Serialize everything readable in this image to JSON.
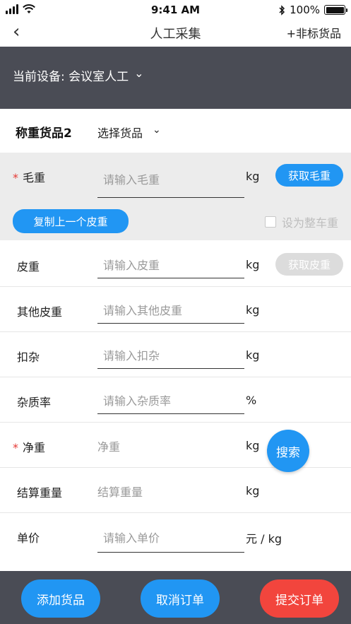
{
  "status_bar": {
    "time": "9:41 AM",
    "battery": "100%",
    "battery_level": 1.0
  },
  "nav": {
    "back_glyph": "‹",
    "title": "人工采集",
    "right_action": "+非标货品"
  },
  "device": {
    "label": "当前设备: 会议室人工",
    "chevron": "⌄"
  },
  "goods": {
    "label": "称重货品2",
    "select_label": "选择货品",
    "chevron": "⌄"
  },
  "gross": {
    "label": "毛重",
    "required_mark": "*",
    "placeholder": "请输入毛重",
    "unit": "kg",
    "fetch_button": "获取毛重",
    "copy_button": "复制上一个皮重",
    "whole_truck_checkbox": "设为整车重"
  },
  "fields": {
    "tare": {
      "label": "皮重",
      "placeholder": "请输入皮重",
      "unit": "kg",
      "fetch_button": "获取皮重"
    },
    "other_tare": {
      "label": "其他皮重",
      "placeholder": "请输入其他皮重",
      "unit": "kg"
    },
    "deduction": {
      "label": "扣杂",
      "placeholder": "请输入扣杂",
      "unit": "kg"
    },
    "impurity_rate": {
      "label": "杂质率",
      "placeholder": "请输入杂质率",
      "unit": "%"
    },
    "net": {
      "label": "净重",
      "required_mark": "*",
      "value": "净重",
      "unit": "kg"
    },
    "settle": {
      "label": "结算重量",
      "value": "结算重量",
      "unit": "kg"
    },
    "price": {
      "label": "单价",
      "placeholder": "请输入单价",
      "unit": "元 / kg"
    }
  },
  "search_button": "搜索",
  "bottom": {
    "add": "添加货品",
    "cancel": "取消订单",
    "submit": "提交订单"
  },
  "colors": {
    "accent": "#2196f3",
    "danger": "#f2453d",
    "dark_bar": "#4a4c55",
    "gray_section": "#ececec",
    "disabled": "#dcdcdc"
  }
}
